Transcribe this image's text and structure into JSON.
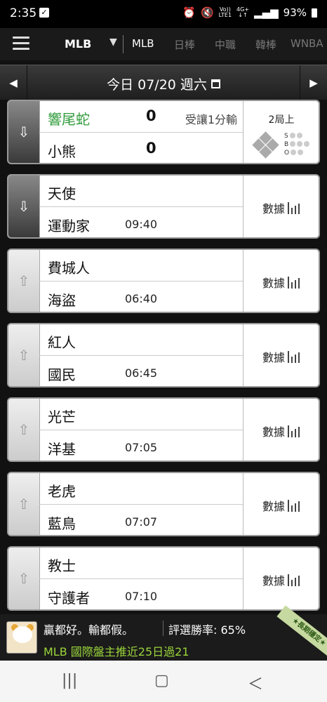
{
  "status_bar": {
    "time": "2:35",
    "battery": "93%",
    "net_top": "Vo))",
    "net_bottom": "LTE1",
    "gen_top": "4G+",
    "gen_bottom": "↓↑"
  },
  "nav": {
    "league_select": "MLB",
    "tabs": [
      "MLB",
      "日棒",
      "中職",
      "韓棒",
      "WNBA"
    ]
  },
  "date_bar": {
    "label": "今日 07/20 週六"
  },
  "games": [
    {
      "away": "響尾蛇",
      "home": "小熊",
      "away_score": "0",
      "home_score": "0",
      "note": "受讓1分輸",
      "inning": "2局上",
      "count_labels": [
        "S",
        "B",
        "O"
      ]
    },
    {
      "away": "天使",
      "home": "運動家",
      "time": "09:40",
      "stats_label": "數據"
    },
    {
      "away": "費城人",
      "home": "海盜",
      "time": "06:40",
      "stats_label": "數據"
    },
    {
      "away": "紅人",
      "home": "國民",
      "time": "06:45",
      "stats_label": "數據"
    },
    {
      "away": "光芒",
      "home": "洋基",
      "time": "07:05",
      "stats_label": "數據"
    },
    {
      "away": "老虎",
      "home": "藍鳥",
      "time": "07:07",
      "stats_label": "數據"
    },
    {
      "away": "教士",
      "home": "守護者",
      "time": "07:10",
      "stats_label": "數據"
    }
  ],
  "banner": {
    "tagline": "贏都好。輸都假。",
    "win_rate": "評選勝率: 65%",
    "promo": "MLB 國際盤主推近25日過21",
    "ribbon": "★長期穩定★"
  }
}
